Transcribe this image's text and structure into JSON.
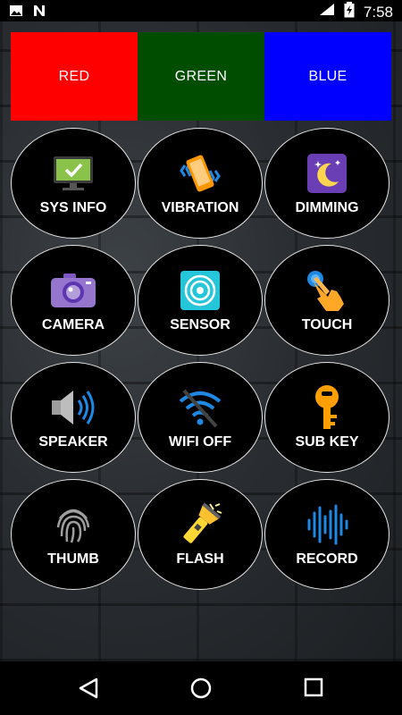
{
  "status_bar": {
    "time": "7:58",
    "icons": [
      "image-icon",
      "n-notification-icon",
      "wifi-icon",
      "battery-charging-icon"
    ]
  },
  "colors": {
    "red": {
      "label": "RED",
      "color": "#ff0000"
    },
    "green": {
      "label": "GREEN",
      "color": "#004d00"
    },
    "blue": {
      "label": "BLUE",
      "color": "#0000ff"
    }
  },
  "buttons": [
    {
      "label": "SYS INFO",
      "icon": "monitor-check-icon"
    },
    {
      "label": "VIBRATION",
      "icon": "vibrating-phone-icon"
    },
    {
      "label": "DIMMING",
      "icon": "moon-stars-icon"
    },
    {
      "label": "CAMERA",
      "icon": "camera-icon"
    },
    {
      "label": "SENSOR",
      "icon": "sensor-icon"
    },
    {
      "label": "TOUCH",
      "icon": "touch-hand-icon"
    },
    {
      "label": "SPEAKER",
      "icon": "speaker-icon"
    },
    {
      "label": "WIFI OFF",
      "icon": "wifi-off-icon"
    },
    {
      "label": "SUB KEY",
      "icon": "key-icon"
    },
    {
      "label": "THUMB",
      "icon": "fingerprint-icon"
    },
    {
      "label": "FLASH",
      "icon": "flashlight-icon"
    },
    {
      "label": "RECORD",
      "icon": "sound-wave-icon"
    }
  ],
  "nav": [
    "back-icon",
    "home-icon",
    "recents-icon"
  ]
}
